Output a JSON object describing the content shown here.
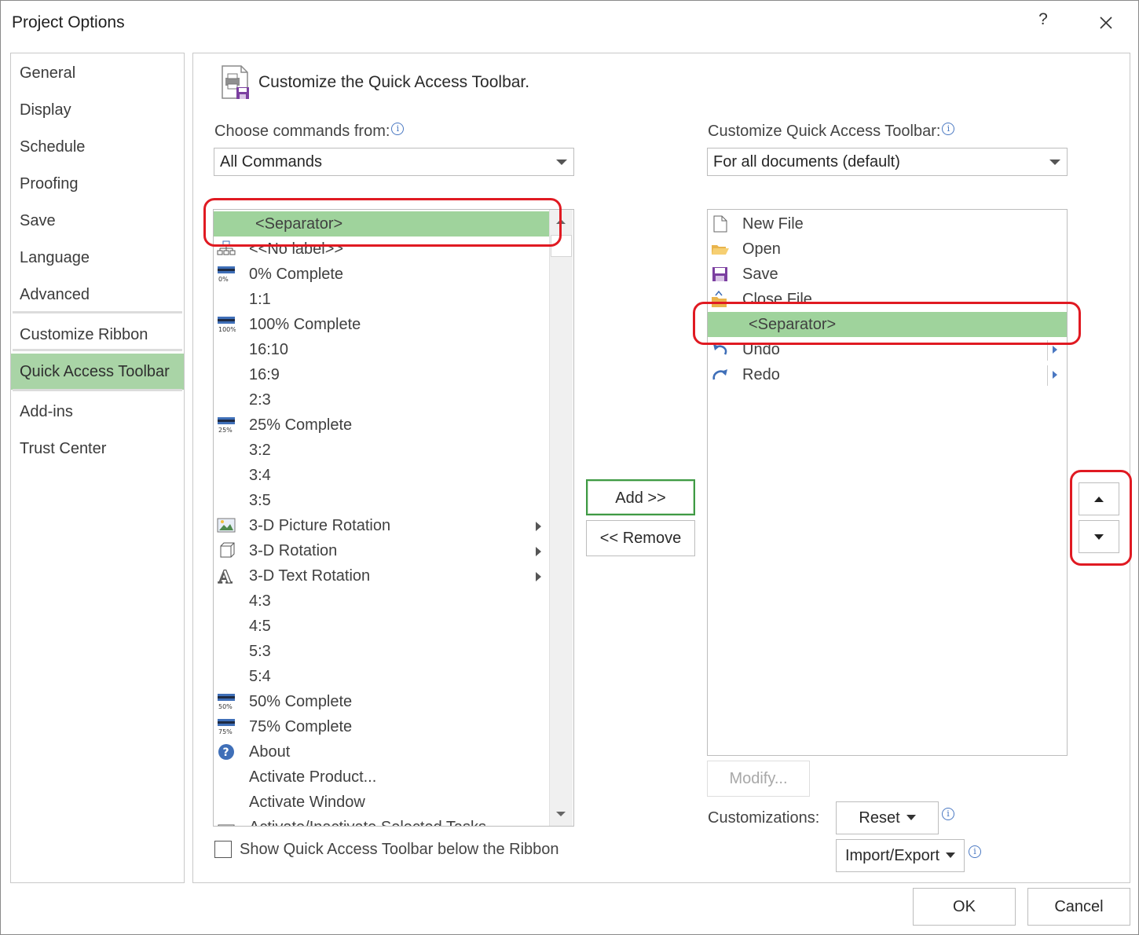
{
  "window": {
    "title": "Project Options",
    "help": "?",
    "close_icon": "close-icon"
  },
  "nav": [
    {
      "label": "General"
    },
    {
      "label": "Display"
    },
    {
      "label": "Schedule"
    },
    {
      "label": "Proofing"
    },
    {
      "label": "Save"
    },
    {
      "label": "Language"
    },
    {
      "label": "Advanced"
    },
    {
      "label": "Customize Ribbon"
    },
    {
      "label": "Quick Access Toolbar",
      "active": true
    },
    {
      "label": "Add-ins"
    },
    {
      "label": "Trust Center"
    }
  ],
  "main": {
    "heading": "Customize the Quick Access Toolbar.",
    "choose_label": "Choose commands from:",
    "choose_value": "All Commands",
    "customize_label": "Customize Quick Access Toolbar:",
    "customize_value": "For all documents (default)"
  },
  "commands": [
    {
      "label": "<Separator>",
      "icon": "",
      "selected": true
    },
    {
      "label": "<<No label>>",
      "icon": "org-chart-icon"
    },
    {
      "label": "0% Complete",
      "icon": "progress-0-icon",
      "badge": "0%"
    },
    {
      "label": "1:1",
      "icon": ""
    },
    {
      "label": "100% Complete",
      "icon": "progress-100-icon",
      "badge": "100%"
    },
    {
      "label": "16:10",
      "icon": ""
    },
    {
      "label": "16:9",
      "icon": ""
    },
    {
      "label": "2:3",
      "icon": ""
    },
    {
      "label": "25% Complete",
      "icon": "progress-25-icon",
      "badge": "25%"
    },
    {
      "label": "3:2",
      "icon": ""
    },
    {
      "label": "3:4",
      "icon": ""
    },
    {
      "label": "3:5",
      "icon": ""
    },
    {
      "label": "3-D Picture Rotation",
      "icon": "picture-rotation-icon",
      "submenu": true
    },
    {
      "label": "3-D Rotation",
      "icon": "cube-rotation-icon",
      "submenu": true
    },
    {
      "label": "3-D Text Rotation",
      "icon": "text-rotation-icon",
      "submenu": true
    },
    {
      "label": "4:3",
      "icon": ""
    },
    {
      "label": "4:5",
      "icon": ""
    },
    {
      "label": "5:3",
      "icon": ""
    },
    {
      "label": "5:4",
      "icon": ""
    },
    {
      "label": "50% Complete",
      "icon": "progress-50-icon",
      "badge": "50%"
    },
    {
      "label": "75% Complete",
      "icon": "progress-75-icon",
      "badge": "75%"
    },
    {
      "label": "About",
      "icon": "help-circle-icon"
    },
    {
      "label": "Activate Product...",
      "icon": ""
    },
    {
      "label": "Activate Window",
      "icon": ""
    },
    {
      "label": "Activate/Inactivate Selected Tasks",
      "icon": "tasks-icon"
    }
  ],
  "toolbar_items": [
    {
      "label": "New File",
      "icon": "new-file-icon"
    },
    {
      "label": "Open",
      "icon": "open-folder-icon"
    },
    {
      "label": "Save",
      "icon": "save-icon"
    },
    {
      "label": "Close File",
      "icon": "close-file-icon"
    },
    {
      "label": "<Separator>",
      "icon": "",
      "selected": true
    },
    {
      "label": "Undo",
      "icon": "undo-icon",
      "submenu": true
    },
    {
      "label": "Redo",
      "icon": "redo-icon",
      "submenu": true
    }
  ],
  "buttons": {
    "add": "Add >>",
    "remove": "<< Remove",
    "modify": "Modify...",
    "reset": "Reset",
    "import_export": "Import/Export",
    "ok": "OK",
    "cancel": "Cancel"
  },
  "labels": {
    "customizations": "Customizations:",
    "show_below": "Show Quick Access Toolbar below the Ribbon"
  },
  "colors": {
    "selection": "#9fd39c",
    "nav_active": "#a9d4a6",
    "highlight": "#e01a22",
    "accent_blue": "#4a78c2"
  }
}
